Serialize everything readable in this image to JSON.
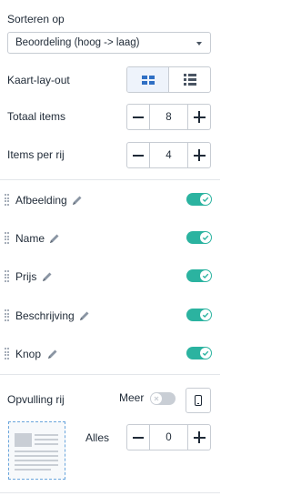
{
  "sort": {
    "label": "Sorteren op",
    "selected": "Beoordeling (hoog -> laag)"
  },
  "layout": {
    "label": "Kaart-lay-out",
    "options": [
      "grid",
      "list"
    ],
    "selected": "grid"
  },
  "total_items": {
    "label": "Totaal items",
    "value": "8"
  },
  "items_per_row": {
    "label": "Items per rij",
    "value": "4"
  },
  "fields": [
    {
      "name": "Afbeelding",
      "enabled": true
    },
    {
      "name": "Name",
      "enabled": true
    },
    {
      "name": "Prijs",
      "enabled": true
    },
    {
      "name": "Beschrijving",
      "enabled": true
    },
    {
      "name": "Knop",
      "enabled": true
    }
  ],
  "row_fill": {
    "label": "Opvulling rij",
    "more_label": "Meer",
    "more_enabled": false,
    "all_label": "Alles",
    "all_value": "0"
  },
  "colors": {
    "toggle_on": "#2bb3a0",
    "toggle_off": "#c9ced5",
    "accent": "#2f6fc4"
  }
}
